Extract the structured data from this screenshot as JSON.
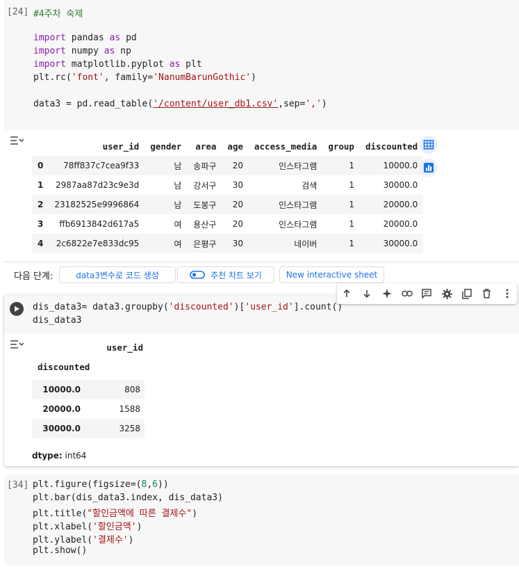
{
  "cell24": {
    "exec": "[24]",
    "lines": [
      [
        {
          "t": "#4주차 숙제",
          "c": "cm"
        }
      ],
      [],
      [
        {
          "t": "import",
          "c": "kw"
        },
        {
          "t": " pandas ",
          "c": "plain"
        },
        {
          "t": "as",
          "c": "kw"
        },
        {
          "t": " pd",
          "c": "plain"
        }
      ],
      [
        {
          "t": "import",
          "c": "kw"
        },
        {
          "t": " numpy ",
          "c": "plain"
        },
        {
          "t": "as",
          "c": "kw"
        },
        {
          "t": " np",
          "c": "plain"
        }
      ],
      [
        {
          "t": "import",
          "c": "kw"
        },
        {
          "t": " matplotlib.pyplot ",
          "c": "plain"
        },
        {
          "t": "as",
          "c": "kw"
        },
        {
          "t": " plt",
          "c": "plain"
        }
      ],
      [
        {
          "t": "plt.rc(",
          "c": "plain"
        },
        {
          "t": "'font'",
          "c": "str"
        },
        {
          "t": ", family=",
          "c": "plain"
        },
        {
          "t": "'NanumBarunGothic'",
          "c": "str"
        },
        {
          "t": ")",
          "c": "plain"
        }
      ],
      [],
      [
        {
          "t": "data3 = pd.read_table(",
          "c": "plain"
        },
        {
          "t": "'/content/user_db1.csv'",
          "c": "str ulink"
        },
        {
          "t": ",sep=",
          "c": "plain"
        },
        {
          "t": "','",
          "c": "str"
        },
        {
          "t": ")",
          "c": "plain"
        }
      ]
    ]
  },
  "df_output": {
    "columns": [
      "",
      "user_id",
      "gender",
      "area",
      "age",
      "access_media",
      "group",
      "discounted"
    ],
    "rows": [
      [
        "0",
        "78ff837c7cea9f33",
        "남",
        "송파구",
        "20",
        "인스타그램",
        "1",
        "10000.0"
      ],
      [
        "1",
        "2987aa87d23c9e3d",
        "남",
        "강서구",
        "30",
        "검색",
        "1",
        "30000.0"
      ],
      [
        "2",
        "23182525e9996864",
        "남",
        "도봉구",
        "20",
        "인스타그램",
        "1",
        "20000.0"
      ],
      [
        "3",
        "ffb6913842d617a5",
        "여",
        "용산구",
        "20",
        "인스타그램",
        "1",
        "20000.0"
      ],
      [
        "4",
        "2c6822e7e833dc95",
        "여",
        "은평구",
        "30",
        "네이버",
        "1",
        "30000.0"
      ]
    ]
  },
  "next_steps": {
    "label": "다음 단계:",
    "btn1": "data3변수로 코드 생성",
    "btn2": "추천 차트 보기",
    "btn3": "New interactive sheet"
  },
  "cell_focus": {
    "lines": [
      [
        {
          "t": "dis_data3= data3.groupby(",
          "c": "plain"
        },
        {
          "t": "'discounted'",
          "c": "str"
        },
        {
          "t": ")[",
          "c": "plain"
        },
        {
          "t": "'user_id'",
          "c": "str"
        },
        {
          "t": "].count()",
          "c": "plain"
        }
      ],
      [
        {
          "t": "dis_data3",
          "c": "plain"
        }
      ]
    ]
  },
  "series_output": {
    "col_header": "user_id",
    "index_name": "discounted",
    "rows": [
      [
        "10000.0",
        "808"
      ],
      [
        "20000.0",
        "1588"
      ],
      [
        "30000.0",
        "3258"
      ]
    ],
    "dtype_label": "dtype:",
    "dtype_value": "int64"
  },
  "cell34": {
    "exec": "[34]",
    "lines": [
      [
        {
          "t": "plt.figure(figsize=(",
          "c": "plain"
        },
        {
          "t": "8",
          "c": "num"
        },
        {
          "t": ",",
          "c": "plain"
        },
        {
          "t": "6",
          "c": "num"
        },
        {
          "t": "))",
          "c": "plain"
        }
      ],
      [
        {
          "t": "plt.bar(dis_data3.index, dis_data3)",
          "c": "plain"
        }
      ],
      [
        {
          "t": "plt.title(",
          "c": "plain"
        },
        {
          "t": "\"할인금액에 따른 결제수\"",
          "c": "str"
        },
        {
          "t": ")",
          "c": "plain"
        }
      ],
      [
        {
          "t": "plt.xlabel(",
          "c": "plain"
        },
        {
          "t": "'할인금액'",
          "c": "str"
        },
        {
          "t": ")",
          "c": "plain"
        }
      ],
      [
        {
          "t": "plt.ylabel(",
          "c": "plain"
        },
        {
          "t": "'결제수'",
          "c": "str"
        },
        {
          "t": ")",
          "c": "plain"
        }
      ],
      [
        {
          "t": "plt.show()",
          "c": "plain"
        }
      ]
    ]
  }
}
